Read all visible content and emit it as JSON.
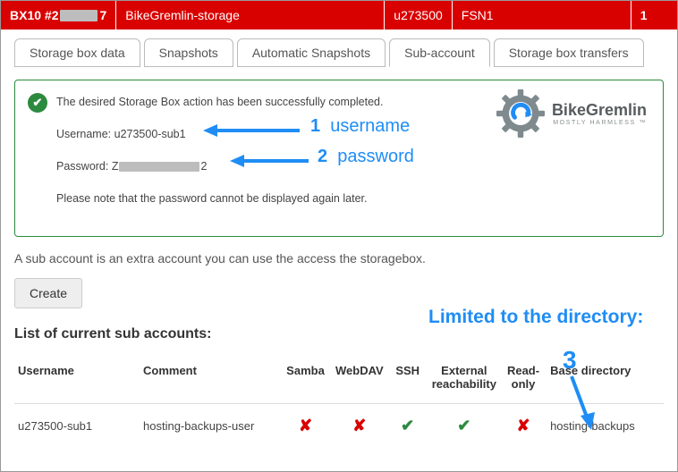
{
  "topbar": {
    "product": "BX10 #2",
    "product_suffix": "7",
    "name": "BikeGremlin-storage",
    "user": "u273500",
    "dc": "FSN1",
    "trailing": "1"
  },
  "tabs": [
    {
      "label": "Storage box data",
      "active": false
    },
    {
      "label": "Snapshots",
      "active": false
    },
    {
      "label": "Automatic Snapshots",
      "active": false
    },
    {
      "label": "Sub-account",
      "active": true
    },
    {
      "label": "Storage box transfers",
      "active": false
    }
  ],
  "success": {
    "message": "The desired Storage Box action has been successfully completed.",
    "username_label": "Username:",
    "username_value": "u273500-sub1",
    "password_label": "Password:",
    "password_prefix": "Z",
    "password_suffix": "2",
    "note": "Please note that the password cannot be displayed again later."
  },
  "logo": {
    "brand1": "Bike",
    "brand2": "Gremlin",
    "slogan": "MOSTLY HARMLESS ™"
  },
  "annot": {
    "a1_num": "1",
    "a1_text": "username",
    "a2_num": "2",
    "a2_text": "password",
    "dir_text": "Limited to the directory:",
    "a3_num": "3"
  },
  "body": {
    "desc": "A sub account is an extra account you can use the access the storagebox.",
    "create": "Create",
    "list_title": "List of current sub accounts:",
    "headers": {
      "username": "Username",
      "comment": "Comment",
      "samba": "Samba",
      "webdav": "WebDAV",
      "ssh": "SSH",
      "ext": "External reachability",
      "ro": "Read-only",
      "base": "Base directory"
    },
    "row": {
      "username": "u273500-sub1",
      "comment": "hosting-backups-user",
      "samba": "✘",
      "webdav": "✘",
      "ssh": "✔",
      "ext": "✔",
      "ro": "✘",
      "base": "hosting-backups"
    }
  }
}
